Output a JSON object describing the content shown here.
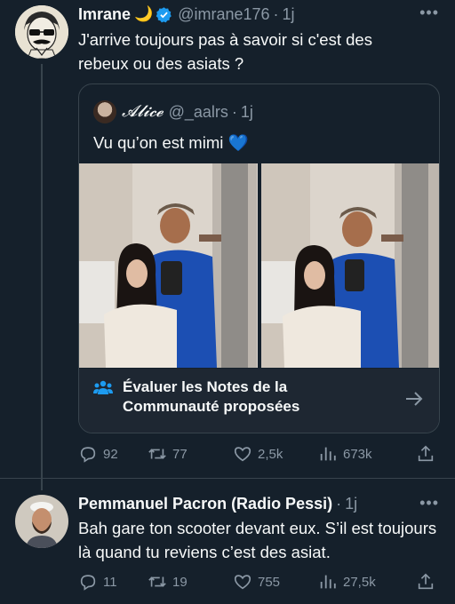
{
  "tweet": {
    "name": "Imrane",
    "moon": "🌙",
    "handle": "@imrane176",
    "separator": "·",
    "time": "1j",
    "text": "J'arrive toujours pas à savoir si c'est des rebeux ou des asiats ?",
    "quote": {
      "name": "𝓐𝓵𝓲𝓬𝓮",
      "handle": "@_aalrs",
      "time": "1j",
      "text": "Vu qu’on est mimi",
      "heart": "💙"
    },
    "notes_label": "Évaluer les Notes de la Communauté proposées",
    "stats": {
      "replies": "92",
      "retweets": "77",
      "likes": "2,5k",
      "views": "673k"
    }
  },
  "reply": {
    "name": "Pemmanuel Pacron (Radio Pessi)",
    "separator": "·",
    "time": "1j",
    "text": "Bah gare ton scooter devant eux. S’il est toujours là quand tu reviens c’est des asiat.",
    "stats": {
      "replies": "11",
      "retweets": "19",
      "likes": "755",
      "views": "27,5k"
    }
  },
  "colors": {
    "background": "#15202b",
    "muted": "#8b98a5",
    "accent": "#1d9bf0",
    "border": "#38444d"
  },
  "icons": [
    "more-icon",
    "verified-icon",
    "reply-icon",
    "retweet-icon",
    "like-icon",
    "views-icon",
    "share-icon",
    "community-notes-icon",
    "arrow-right-icon"
  ]
}
